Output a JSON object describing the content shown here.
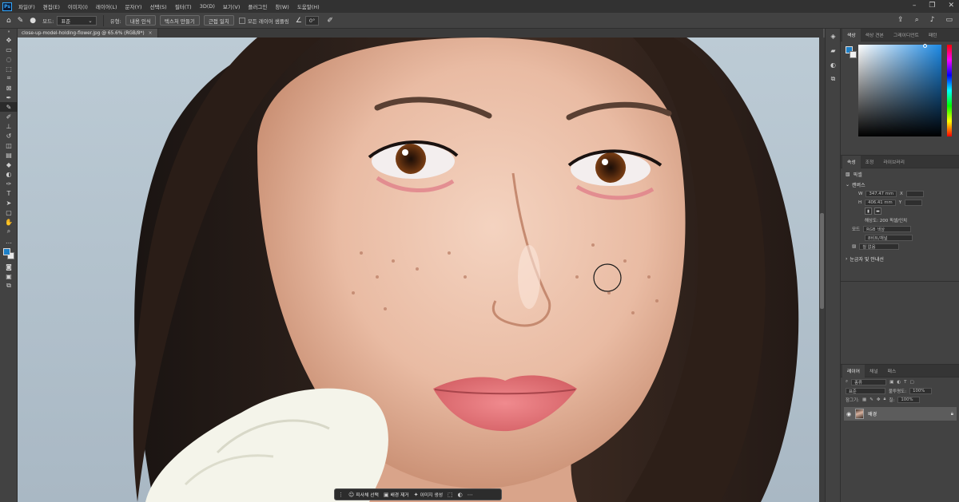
{
  "app": {
    "logo": "Ps",
    "menu": [
      "파일(F)",
      "편집(E)",
      "이미지(I)",
      "레이어(L)",
      "문자(Y)",
      "선택(S)",
      "필터(T)",
      "3D(D)",
      "보기(V)",
      "플러그인",
      "창(W)",
      "도움말(H)"
    ]
  },
  "options_bar": {
    "mode_label": "모드:",
    "mode_value": "표준",
    "type_label": "유형:",
    "btn_content_aware": "내용 인식",
    "btn_create_texture": "텍스처 만들기",
    "btn_proximity": "근접 일치",
    "sample_all_label": "모든 레이어 샘플링",
    "angle_value": "0°"
  },
  "document": {
    "tab_title": "close-up-model-holding-flower.jpg @ 65.6% (RGB/8*)",
    "close_symbol": "×"
  },
  "context_taskbar": {
    "select_subject": "피사체 선택",
    "remove_bg": "배경 제거",
    "generate": "이미지 생성"
  },
  "color_panel": {
    "tabs": [
      "색상",
      "색상 견본",
      "그레이디언트",
      "패턴"
    ],
    "foreground_color": "#1d80c8",
    "background_color": "#f0f0f0"
  },
  "properties_panel": {
    "tabs": [
      "속성",
      "조정",
      "라이브러리"
    ],
    "layer_type": "픽셀",
    "canvas_section": "캔버스",
    "width_label": "W",
    "width_value": "347.47 mm",
    "height_label": "H",
    "height_value": "406.41 mm",
    "x_label": "X",
    "y_label": "Y",
    "resolution_text": "해상도: 200 픽셀/인치",
    "mode_label": "모드",
    "mode_value": "RGB 색상",
    "depth_value": "8비트/채널",
    "fill_label": "칠 없음",
    "rulers_section": "눈금자 및 안내선"
  },
  "layers_panel": {
    "tabs": [
      "레이어",
      "채널",
      "패스"
    ],
    "kind_filter": "종류",
    "blend_mode": "표준",
    "opacity_label": "불투명도:",
    "opacity_value": "100%",
    "lock_label": "잠그기:",
    "fill_label": "칠:",
    "fill_value": "100%",
    "layer_name": "배경"
  }
}
